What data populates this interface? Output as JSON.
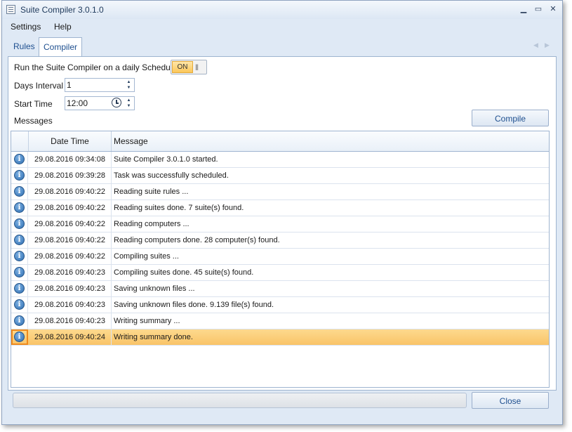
{
  "window": {
    "title": "Suite Compiler 3.0.1.0",
    "minimize": "▬",
    "maximize": "▭",
    "close": "✕"
  },
  "menu": {
    "settings": "Settings",
    "help": "Help"
  },
  "tabs": [
    {
      "label": "Rules",
      "active": false
    },
    {
      "label": "Compiler",
      "active": true
    }
  ],
  "compiler": {
    "schedule_label": "Run the Suite Compiler on a daily Schedule",
    "schedule_toggle": "ON",
    "days_interval_label": "Days Interval",
    "days_interval_value": "1",
    "start_time_label": "Start Time",
    "start_time_value": "12:00",
    "messages_label": "Messages",
    "compile_button": "Compile"
  },
  "grid": {
    "columns": [
      "",
      "Date Time",
      "Message"
    ],
    "rows": [
      {
        "icon": "info-icon",
        "datetime": "29.08.2016 09:34:08",
        "message": "Suite Compiler 3.0.1.0 started."
      },
      {
        "icon": "info-icon",
        "datetime": "29.08.2016 09:39:28",
        "message": "Task was successfully scheduled."
      },
      {
        "icon": "info-icon",
        "datetime": "29.08.2016 09:40:22",
        "message": "Reading suite rules ..."
      },
      {
        "icon": "info-icon",
        "datetime": "29.08.2016 09:40:22",
        "message": "Reading suites done. 7 suite(s) found."
      },
      {
        "icon": "info-icon",
        "datetime": "29.08.2016 09:40:22",
        "message": "Reading computers ..."
      },
      {
        "icon": "info-icon",
        "datetime": "29.08.2016 09:40:22",
        "message": "Reading computers done. 28 computer(s) found."
      },
      {
        "icon": "info-icon",
        "datetime": "29.08.2016 09:40:22",
        "message": "Compiling suites ..."
      },
      {
        "icon": "info-icon",
        "datetime": "29.08.2016 09:40:23",
        "message": "Compiling suites done. 45 suite(s) found."
      },
      {
        "icon": "info-icon",
        "datetime": "29.08.2016 09:40:23",
        "message": "Saving unknown files ..."
      },
      {
        "icon": "info-icon",
        "datetime": "29.08.2016 09:40:23",
        "message": "Saving unknown files done. 9.139 file(s) found."
      },
      {
        "icon": "info-icon",
        "datetime": "29.08.2016 09:40:23",
        "message": "Writing summary ..."
      },
      {
        "icon": "info-icon",
        "datetime": "29.08.2016 09:40:24",
        "message": "Writing summary done.",
        "selected": true
      }
    ]
  },
  "footer": {
    "progress": 0,
    "close_button": "Close"
  },
  "colors": {
    "accent": "#1e4f8f",
    "selection": "#fbc96f",
    "toggle_on": "#fbc75a"
  }
}
